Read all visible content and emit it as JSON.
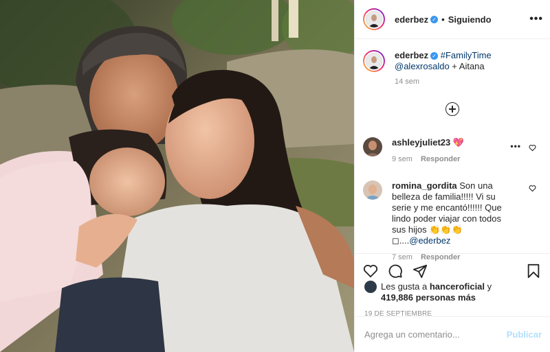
{
  "post_author": {
    "username": "ederbez",
    "verified_icon": "verified-badge-icon",
    "separator": "•",
    "follow_status": "Siguiendo",
    "more_label": "•••"
  },
  "caption": {
    "username": "ederbez",
    "hashtag": "#FamilyTime",
    "mention": "@alexrosaldo",
    "text_after": " + Aitana",
    "time": "14 sem"
  },
  "load_more_icon": "plus-circle-icon",
  "comments": [
    {
      "username": "ashleyjuliet23",
      "text": "💖",
      "time": "9 sem",
      "reply_label": "Responder",
      "more_label": "•••"
    },
    {
      "username": "romina_gordita",
      "text": "Son una belleza de familia!!!!! Vi su serie y me encantó!!!!!! Que lindo poder viajar con todos sus hijos 👏👏👏◻....",
      "mention": "@ederbez",
      "time": "7 sem",
      "reply_label": "Responder"
    }
  ],
  "likes": {
    "prefix": "Les gusta a ",
    "user": "hanceroficial",
    "joiner": " y",
    "count_text": "419,886 personas más"
  },
  "date": "19 DE SEPTIEMBRE",
  "comment_input": {
    "placeholder": "Agrega un comentario...",
    "value": "",
    "publish_label": "Publicar"
  },
  "colors": {
    "link": "#00376b",
    "verified": "#3897f0",
    "muted": "#8e8e8e",
    "publish_disabled": "#b2dffc"
  }
}
